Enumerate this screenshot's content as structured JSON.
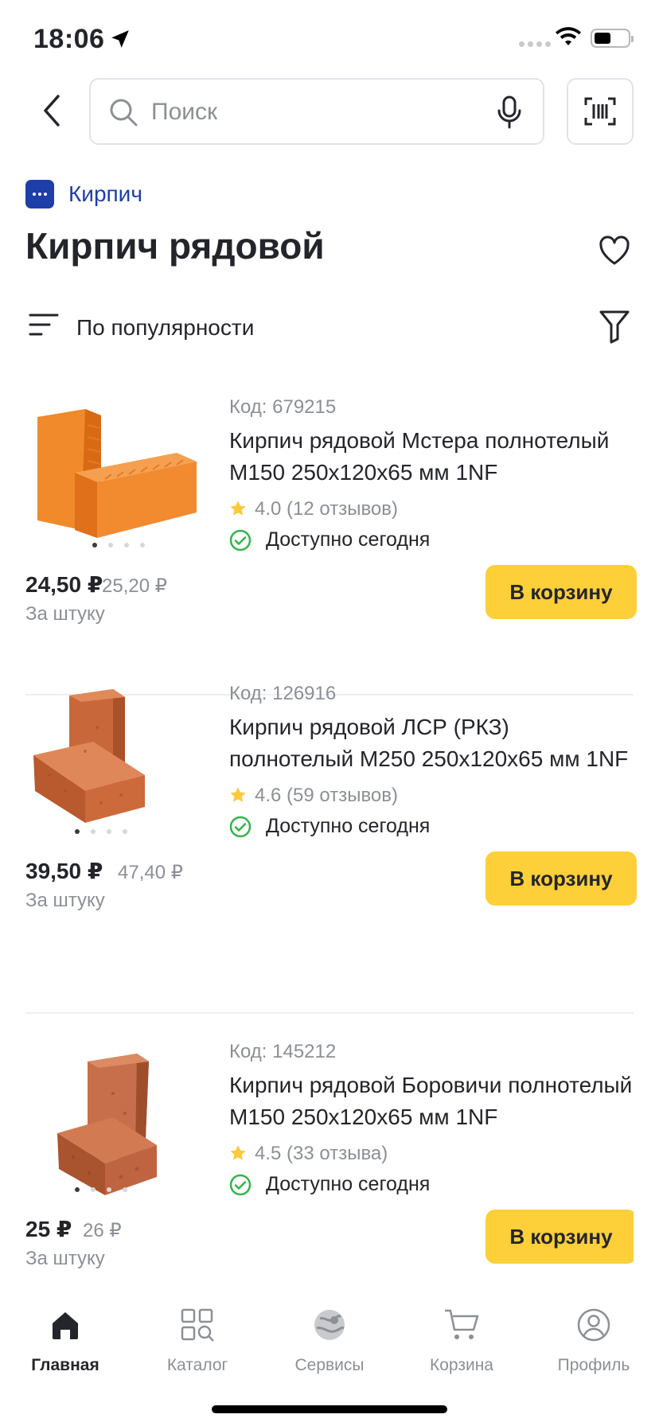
{
  "status_bar": {
    "time": "18:06"
  },
  "header": {
    "search_placeholder": "Поиск",
    "icons": [
      "back-arrow-icon",
      "search-icon",
      "microphone-icon",
      "barcode-scan-icon"
    ]
  },
  "breadcrumb": {
    "label": "Кирпич"
  },
  "page": {
    "title": "Кирпич рядовой"
  },
  "sort": {
    "label": "По популярности"
  },
  "colors": {
    "accent_blue": "#1e3ea8",
    "cart_button": "#fdcf38",
    "star": "#fbc93a",
    "available_green": "#32b44a"
  },
  "products": [
    {
      "code": "Код: 679215",
      "name": "Кирпич рядовой Мстера полнотелый М150 250х120х65 мм 1NF",
      "rating": "4.0 (12 отзывов)",
      "availability": "Доступно сегодня",
      "price": "24,50 ₽",
      "old_price": "25,20 ₽",
      "unit": "За штуку",
      "cart_label": "В корзину"
    },
    {
      "code": "Код: 126916",
      "name": "Кирпич рядовой ЛСР (РКЗ) полнотелый М250 250х120х65 мм 1NF",
      "rating": "4.6 (59 отзывов)",
      "availability": "Доступно сегодня",
      "price": "39,50 ₽",
      "old_price": "47,40 ₽",
      "unit": "За штуку",
      "cart_label": "В корзину"
    },
    {
      "code": "Код: 145212",
      "name": "Кирпич рядовой Боровичи полнотелый М150 250х120х65 мм 1NF",
      "rating": "4.5 (33 отзыва)",
      "availability": "Доступно сегодня",
      "price": "25 ₽",
      "old_price": "26 ₽",
      "unit": "За штуку",
      "cart_label": "В корзину"
    }
  ],
  "tabbar": {
    "items": [
      {
        "label": "Главная",
        "icon": "home-icon"
      },
      {
        "label": "Каталог",
        "icon": "catalog-icon"
      },
      {
        "label": "Сервисы",
        "icon": "services-icon"
      },
      {
        "label": "Корзина",
        "icon": "cart-icon"
      },
      {
        "label": "Профиль",
        "icon": "profile-icon"
      }
    ]
  }
}
